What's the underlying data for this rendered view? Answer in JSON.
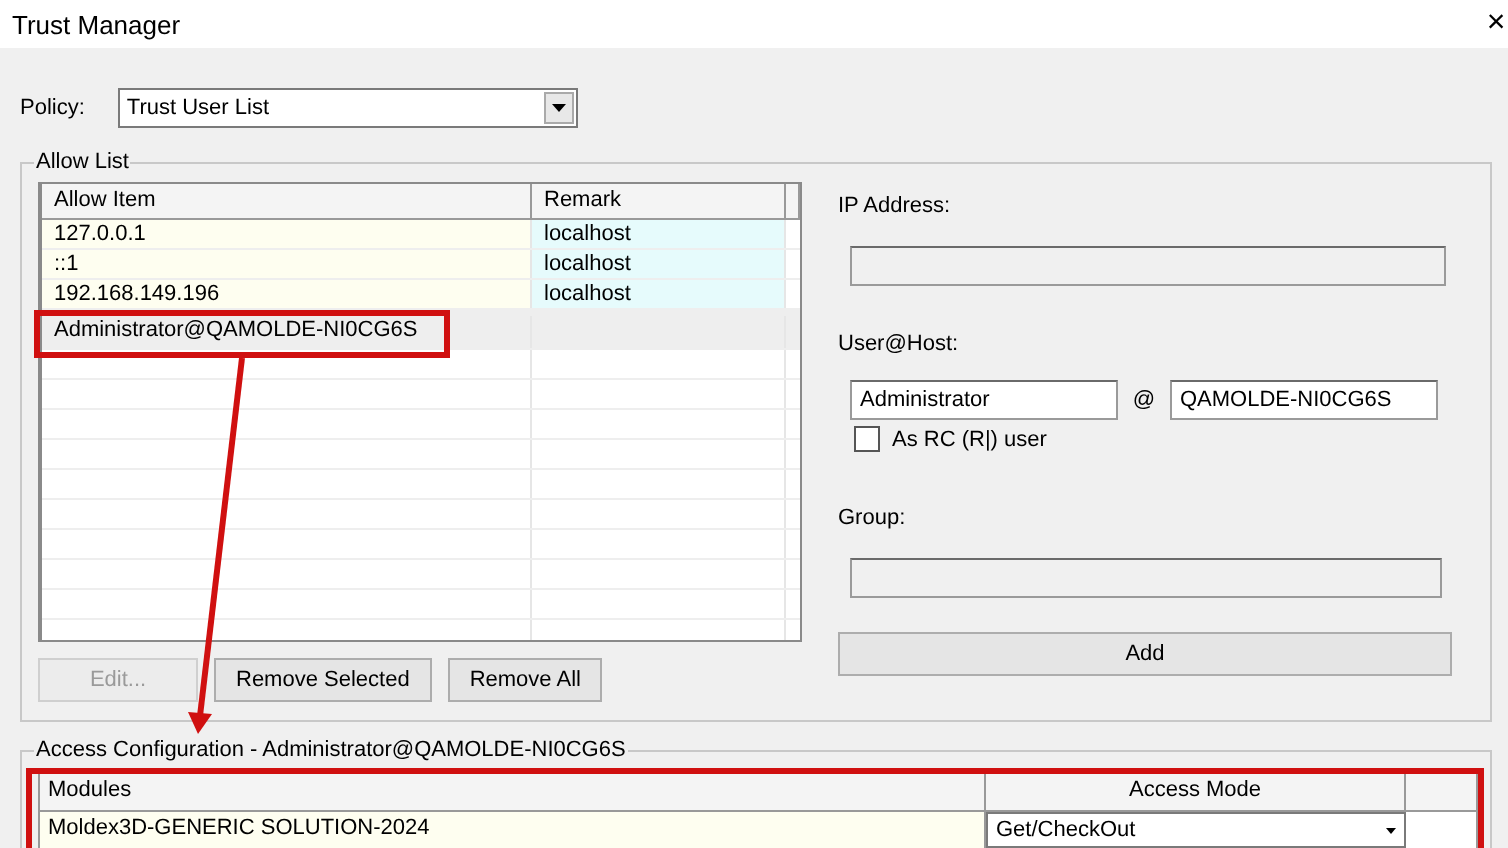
{
  "window": {
    "title": "Trust Manager",
    "close": "×"
  },
  "policy": {
    "label": "Policy:",
    "value": "Trust User List"
  },
  "allow_list": {
    "title": "Allow List",
    "columns": [
      "Allow Item",
      "Remark"
    ],
    "rows": [
      {
        "item": "127.0.0.1",
        "remark": "localhost",
        "selected": false,
        "highlighted": true
      },
      {
        "item": "::1",
        "remark": "localhost",
        "selected": false,
        "highlighted": true
      },
      {
        "item": "192.168.149.196",
        "remark": "localhost",
        "selected": false,
        "highlighted": true
      },
      {
        "item": "Administrator@QAMOLDE-NI0CG6S",
        "remark": "",
        "selected": true,
        "highlighted": false
      }
    ],
    "buttons": [
      {
        "label": "Edit...",
        "disabled": true
      },
      {
        "label": "Remove Selected",
        "disabled": false
      },
      {
        "label": "Remove All",
        "disabled": false
      }
    ]
  },
  "entry": {
    "ip_label": "IP Address:",
    "user_host_label": "User@Host:",
    "user": "Administrator",
    "at": "@",
    "host": "QAMOLDE-NI0CG6S",
    "rc_user": {
      "label": "As RC (R|) user",
      "checked": false
    },
    "group_label": "Group:",
    "add_button": "Add"
  },
  "access": {
    "title": "Access Configuration - Administrator@QAMOLDE-NI0CG6S",
    "columns": [
      "Modules",
      "Access Mode"
    ],
    "rows": [
      {
        "module": "Moldex3D-GENERIC SOLUTION-2024",
        "mode": "Get/CheckOut"
      }
    ]
  }
}
